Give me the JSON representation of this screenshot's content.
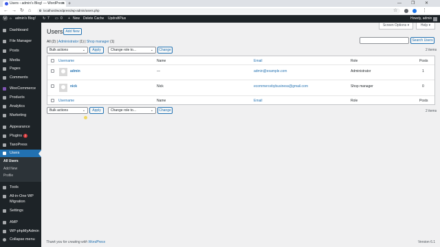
{
  "browser": {
    "tab_title": "Users ‹ admin's Blog! — WordPress",
    "url": "localhost/wordpress/wp-admin/users.php"
  },
  "adminbar": {
    "site": "admin's Blog!",
    "updates": "7",
    "comments": "0",
    "new": "New",
    "cache": "Delete Cache",
    "plugin": "UpdraftPlus",
    "howdy": "Howdy, admin"
  },
  "sidebar": {
    "items": [
      {
        "label": "Dashboard"
      },
      {
        "label": "File Manager"
      },
      {
        "label": "Posts"
      },
      {
        "label": "Media"
      },
      {
        "label": "Pages"
      },
      {
        "label": "Comments"
      },
      {
        "label": "WooCommerce"
      },
      {
        "label": "Products"
      },
      {
        "label": "Analytics"
      },
      {
        "label": "Marketing"
      },
      {
        "label": "Appearance"
      },
      {
        "label": "Plugins",
        "badge": "2"
      },
      {
        "label": "TaxoPress"
      },
      {
        "label": "Users"
      },
      {
        "label": "Tools"
      },
      {
        "label": "All-in-One WP"
      },
      {
        "label": "Migration"
      },
      {
        "label": "Settings"
      },
      {
        "label": "AMP"
      },
      {
        "label": "WP-phpMyAdmin"
      },
      {
        "label": "Collapse menu"
      }
    ],
    "submenu": [
      "All Users",
      "Add New",
      "Profile"
    ]
  },
  "page": {
    "title": "Users",
    "add_new": "Add New",
    "screen_options": "Screen Options ▾",
    "help": "Help ▾",
    "views": {
      "all": "All",
      "all_count": "(2)",
      "sep": "|",
      "administrator": "Administrator",
      "administrator_count": "(1)",
      "shop_manager": "Shop manager",
      "shop_manager_count": "(1)"
    },
    "search_button": "Search Users",
    "bulk_actions": "Bulk actions",
    "apply": "Apply",
    "change_role": "Change role to...",
    "change": "Change",
    "items_count": "2 items"
  },
  "table": {
    "columns": {
      "username": "Username",
      "name": "Name",
      "email": "Email",
      "role": "Role",
      "posts": "Posts"
    },
    "rows": [
      {
        "username": "admin",
        "name": "—",
        "email": "admin@example.com",
        "role": "Administrator",
        "posts": "1"
      },
      {
        "username": "nick",
        "name": "Nick",
        "email": "ecommercebybusiness@gmail.com",
        "role": "Shop manager",
        "posts": "0"
      }
    ]
  },
  "footer": {
    "thanks": "Thank you for creating with",
    "wordpress": "WordPress",
    "version": "Version 6.1"
  }
}
